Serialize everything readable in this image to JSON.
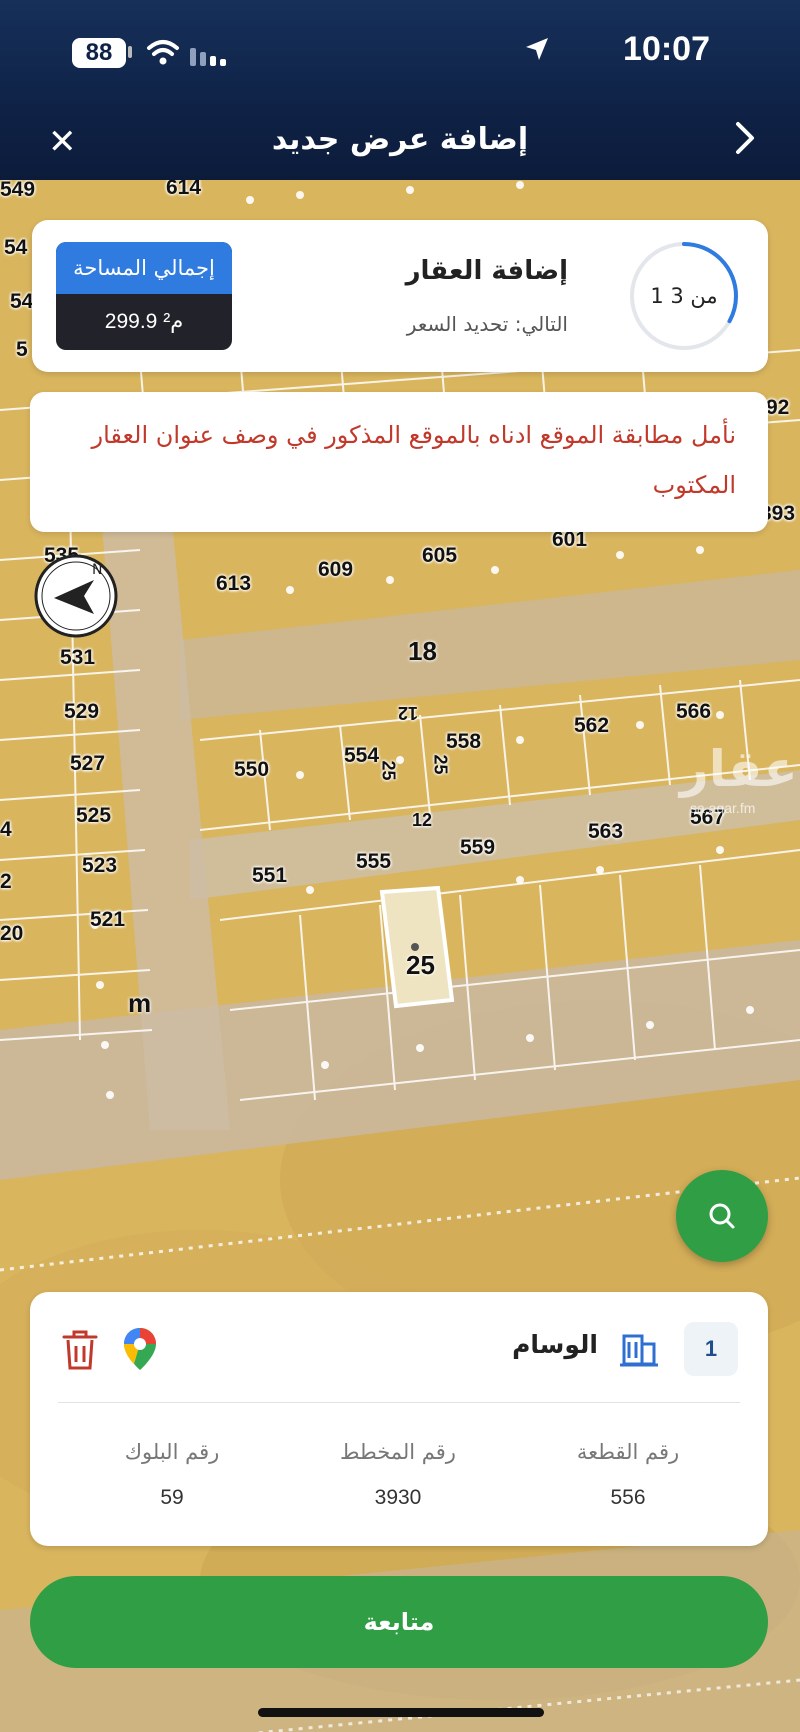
{
  "status_bar": {
    "time": "10:07",
    "battery": "88"
  },
  "header": {
    "title": "إضافة عرض جديد",
    "close_icon": "close-icon",
    "back_icon": "chevron-right-icon"
  },
  "step_card": {
    "area_label": "إجمالي المساحة",
    "area_value": "299.9 م²",
    "title": "إضافة العقار",
    "next": "التالي: تحديد السعر",
    "step": "1 من 3",
    "step_progress": 0.33
  },
  "notice": {
    "text": "نأمل مطابقة الموقع ادناه بالموقع المذكور في وصف عنوان العقار المكتوب"
  },
  "map": {
    "plots": [
      "549",
      "614",
      "54",
      "54",
      "5",
      "535",
      "531",
      "529",
      "527",
      "525",
      "523",
      "521",
      "613",
      "609",
      "605",
      "601",
      "550",
      "554",
      "558",
      "562",
      "566",
      "551",
      "555",
      "559",
      "563",
      "567",
      "12",
      "25",
      "25",
      "12",
      "20",
      "2",
      "4",
      "393",
      "92"
    ],
    "roads": [
      "18",
      "25",
      "m"
    ],
    "watermark": "عقار",
    "watermark_sub": "sa.aqar.fm"
  },
  "property": {
    "index": "1",
    "name": "الوسام",
    "plot_label": "رقم القطعة",
    "plot_value": "556",
    "scheme_label": "رقم المخطط",
    "scheme_value": "3930",
    "block_label": "رقم البلوك",
    "block_value": "59"
  },
  "continue_button": "متابعة",
  "colors": {
    "header": "#0f2246",
    "accent_green": "#2f9e44",
    "area_blue": "#2f7be0",
    "notice_red": "#c0392b"
  }
}
